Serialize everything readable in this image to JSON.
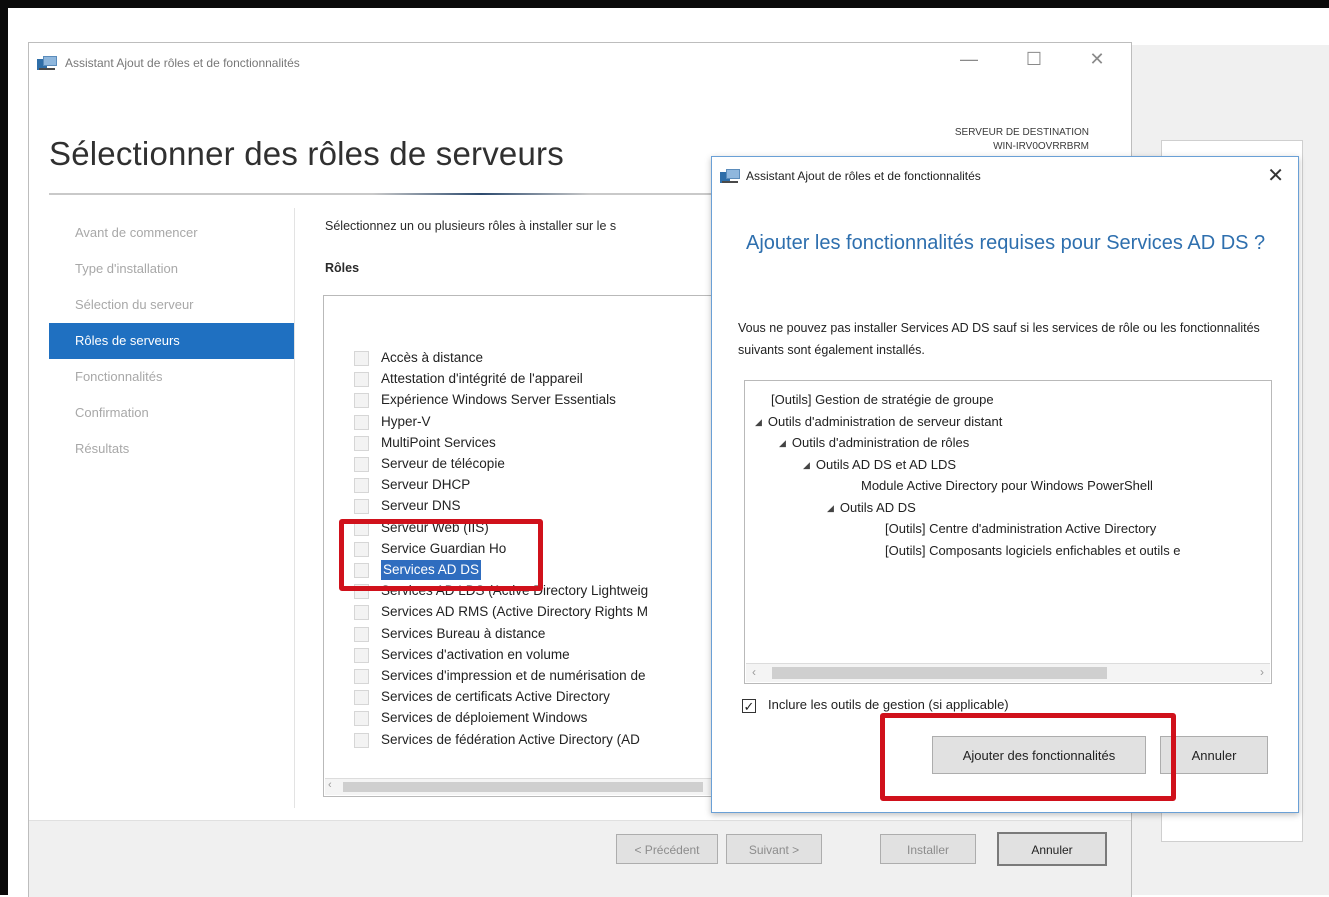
{
  "window": {
    "title": "Assistant Ajout de rôles et de fonctionnalités",
    "controls": {
      "minimize": "—",
      "maximize": "☐",
      "close": "✕"
    }
  },
  "page_title": "Sélectionner des rôles de serveurs",
  "destination": {
    "label": "SERVEUR DE DESTINATION",
    "name": "WIN-IRV0OVRRBRM"
  },
  "nav": [
    {
      "label": "Avant de commencer",
      "active": false
    },
    {
      "label": "Type d'installation",
      "active": false
    },
    {
      "label": "Sélection du serveur",
      "active": false
    },
    {
      "label": "Rôles de serveurs",
      "active": true
    },
    {
      "label": "Fonctionnalités",
      "active": false
    },
    {
      "label": "Confirmation",
      "active": false
    },
    {
      "label": "Résultats",
      "active": false
    }
  ],
  "instruction": "Sélectionnez un ou plusieurs rôles à installer sur le s",
  "roles_label": "Rôles",
  "roles": [
    "Accès à distance",
    "Attestation d'intégrité de l'appareil",
    "Expérience Windows Server Essentials",
    "Hyper-V",
    "MultiPoint Services",
    "Serveur de télécopie",
    "Serveur DHCP",
    "Serveur DNS",
    "Serveur Web (IIS)",
    "Service Guardian Ho",
    "Services AD DS",
    "Services AD LDS (Active Directory Lightweig",
    "Services AD RMS (Active Directory Rights M",
    "Services Bureau à distance",
    "Services d'activation en volume",
    "Services d'impression et de numérisation de",
    "Services de certificats Active Directory",
    "Services de déploiement Windows",
    "Services de fédération Active Directory (AD"
  ],
  "selected_role": "Services AD DS",
  "footer": {
    "previous": "< Précédent",
    "next": "Suivant >",
    "install": "Installer",
    "cancel": "Annuler"
  },
  "dialog": {
    "title": "Assistant Ajout de rôles et de fonctionnalités",
    "close": "✕",
    "heading": "Ajouter les fonctionnalités requises pour Services AD DS ?",
    "message": "Vous ne pouvez pas installer Services AD DS sauf si les services de rôle ou les fonctionnalités suivants sont également installés.",
    "features": [
      {
        "text": "[Outils] Gestion de stratégie de groupe",
        "level": 0,
        "expander": false
      },
      {
        "text": "Outils d'administration de serveur distant",
        "level": 0,
        "expander": true
      },
      {
        "text": "Outils d'administration de rôles",
        "level": 1,
        "expander": true
      },
      {
        "text": "Outils AD DS et AD LDS",
        "level": 2,
        "expander": true
      },
      {
        "text": "Module Active Directory pour Windows PowerShell",
        "level": 3,
        "expander": false
      },
      {
        "text": "Outils AD DS",
        "level": 3,
        "expander": true
      },
      {
        "text": "[Outils] Centre d'administration Active Directory",
        "level": 4,
        "expander": false
      },
      {
        "text": "[Outils] Composants logiciels enfichables et outils e",
        "level": 4,
        "expander": false
      }
    ],
    "include_tools": {
      "label": "Inclure les outils de gestion (si applicable)",
      "checked": true
    },
    "add_button": "Ajouter des fonctionnalités",
    "cancel_button": "Annuler"
  },
  "colors": {
    "accent": "#1f70c1",
    "dialog_heading": "#2e6fae",
    "highlight": "#d0111b",
    "selection": "#2f6dbf"
  }
}
